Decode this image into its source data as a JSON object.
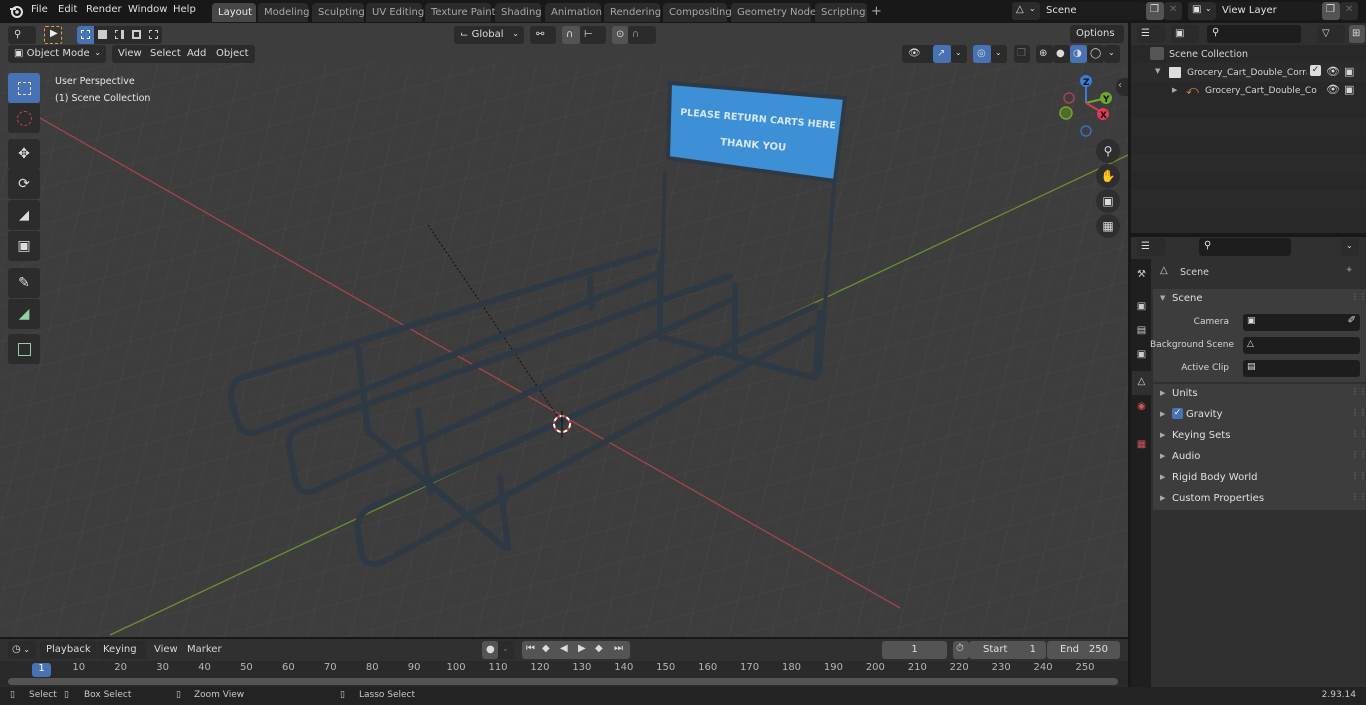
{
  "topbar": {
    "menus": [
      "File",
      "Edit",
      "Render",
      "Window",
      "Help"
    ],
    "workspaces": [
      "Layout",
      "Modeling",
      "Sculpting",
      "UV Editing",
      "Texture Paint",
      "Shading",
      "Animation",
      "Rendering",
      "Compositing",
      "Geometry Nodes",
      "Scripting"
    ],
    "active_workspace": "Layout",
    "add_workspace": "+",
    "scene_name": "Scene",
    "view_layer_name": "View Layer"
  },
  "viewport": {
    "mode": "Object Mode",
    "menus": [
      "View",
      "Select",
      "Add",
      "Object"
    ],
    "transform_orientation": "Global",
    "options_label": "Options",
    "overlay_title": "User Perspective",
    "overlay_subtitle": "(1) Scene Collection",
    "tools": [
      "select-box",
      "cursor",
      "move",
      "rotate",
      "scale",
      "transform",
      "annotate",
      "measure",
      "add-cube"
    ],
    "gizmo_axes": [
      "Z",
      "Y",
      "X"
    ],
    "sign_text_1": "PLEASE RETURN CARTS HERE",
    "sign_text_2": "THANK YOU",
    "colors": {
      "x_axis": "#c4414f",
      "y_axis": "#6f9a2a",
      "active_blue": "#4772b3",
      "sign_blue": "#3d8fd6"
    }
  },
  "outliner": {
    "root": "Scene Collection",
    "items": [
      {
        "name": "Grocery_Cart_Double_Corral_",
        "type": "collection",
        "checked": true
      },
      {
        "name": "Grocery_Cart_Double_Co",
        "type": "object"
      }
    ]
  },
  "properties": {
    "context_title": "Scene",
    "panel_title": "Scene",
    "fields": [
      {
        "label": "Camera",
        "value": ""
      },
      {
        "label": "Background Scene",
        "value": ""
      },
      {
        "label": "Active Clip",
        "value": ""
      }
    ],
    "subpanels": [
      {
        "label": "Units"
      },
      {
        "label": "Gravity",
        "checkbox": true
      },
      {
        "label": "Keying Sets"
      },
      {
        "label": "Audio"
      },
      {
        "label": "Rigid Body World"
      },
      {
        "label": "Custom Properties"
      }
    ],
    "tabs": [
      "tool",
      "render",
      "output",
      "view-layer",
      "scene",
      "world",
      "texture"
    ]
  },
  "timeline": {
    "menus": [
      "Playback",
      "Keying",
      "View",
      "Marker"
    ],
    "current_frame": "1",
    "start_label": "Start",
    "start_value": "1",
    "end_label": "End",
    "end_value": "250",
    "ticks": [
      "1",
      "10",
      "20",
      "30",
      "40",
      "50",
      "60",
      "70",
      "80",
      "90",
      "100",
      "110",
      "120",
      "130",
      "140",
      "150",
      "160",
      "170",
      "180",
      "190",
      "200",
      "210",
      "220",
      "230",
      "240",
      "250"
    ]
  },
  "statusbar": {
    "hints": [
      "Select",
      "Box Select",
      "Zoom View",
      "Lasso Select"
    ],
    "version": "2.93.14"
  }
}
